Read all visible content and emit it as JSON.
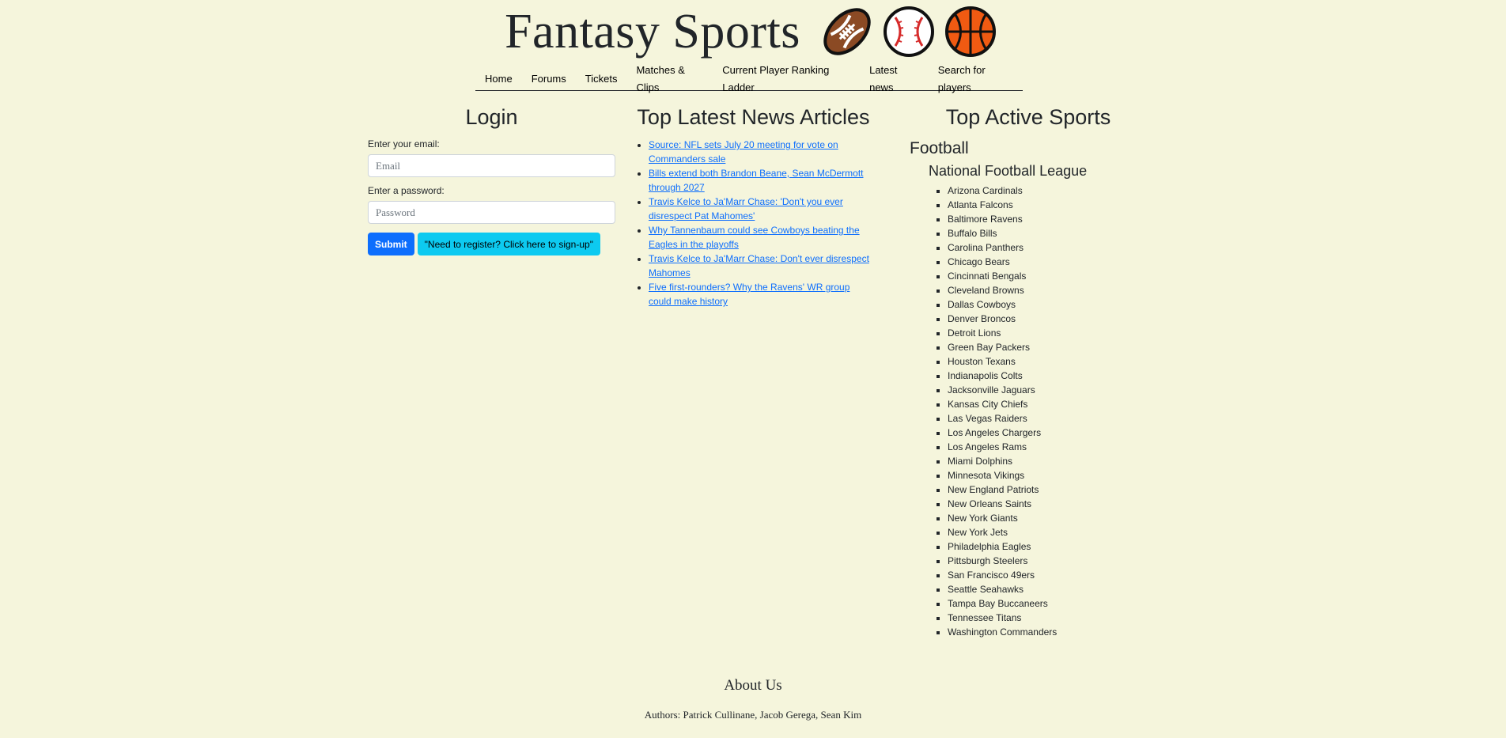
{
  "header": {
    "title": "Fantasy Sports",
    "icons": [
      "football-icon",
      "baseball-icon",
      "basketball-icon"
    ]
  },
  "nav": {
    "items": [
      "Home",
      "Forums",
      "Tickets",
      "Matches & Clips",
      "Current Player Ranking Ladder",
      "Latest news",
      "Search for players"
    ]
  },
  "login": {
    "title": "Login",
    "email_label": "Enter your email:",
    "email_placeholder": "Email",
    "password_label": "Enter a password:",
    "password_placeholder": "Password",
    "submit_label": "Submit",
    "register_label": "\"Need to register? Click here to sign-up\""
  },
  "news": {
    "title": "Top Latest News Articles",
    "articles": [
      "Source: NFL sets July 20 meeting for vote on Commanders sale",
      "Bills extend both Brandon Beane, Sean McDermott through 2027",
      "Travis Kelce to Ja'Marr Chase: 'Don't you ever disrespect Pat Mahomes'",
      "Why Tannenbaum could see Cowboys beating the Eagles in the playoffs",
      "Travis Kelce to Ja'Marr Chase: Don't ever disrespect Mahomes",
      "Five first-rounders? Why the Ravens' WR group could make history"
    ]
  },
  "sports": {
    "title": "Top Active Sports",
    "sport": "Football",
    "league": "National Football League",
    "teams": [
      "Arizona Cardinals",
      "Atlanta Falcons",
      "Baltimore Ravens",
      "Buffalo Bills",
      "Carolina Panthers",
      "Chicago Bears",
      "Cincinnati Bengals",
      "Cleveland Browns",
      "Dallas Cowboys",
      "Denver Broncos",
      "Detroit Lions",
      "Green Bay Packers",
      "Houston Texans",
      "Indianapolis Colts",
      "Jacksonville Jaguars",
      "Kansas City Chiefs",
      "Las Vegas Raiders",
      "Los Angeles Chargers",
      "Los Angeles Rams",
      "Miami Dolphins",
      "Minnesota Vikings",
      "New England Patriots",
      "New Orleans Saints",
      "New York Giants",
      "New York Jets",
      "Philadelphia Eagles",
      "Pittsburgh Steelers",
      "San Francisco 49ers",
      "Seattle Seahawks",
      "Tampa Bay Buccaneers",
      "Tennessee Titans",
      "Washington Commanders"
    ]
  },
  "footer": {
    "about_title": "About Us",
    "authors": "Authors: Patrick Cullinane, Jacob Gerega, Sean Kim"
  },
  "colors": {
    "background": "#f5f5dc",
    "primary": "#0d6efd",
    "info": "#0dcaf0"
  }
}
